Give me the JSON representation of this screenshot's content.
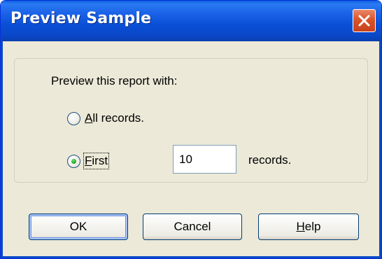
{
  "window": {
    "title": "Preview Sample"
  },
  "group": {
    "prompt": "Preview this report with:"
  },
  "options": {
    "all_records": {
      "label_underlined": "A",
      "label_rest": "ll records.",
      "selected": false
    },
    "first": {
      "label_underlined": "F",
      "label_rest": "irst",
      "selected": true
    }
  },
  "count_input": {
    "value": "10"
  },
  "records_suffix": "records.",
  "buttons": {
    "ok": "OK",
    "cancel": "Cancel",
    "help_underlined": "H",
    "help_rest": "elp"
  },
  "colors": {
    "titlebar": "#0a48c8",
    "close": "#d9542a",
    "dialog_bg": "#ece9d8",
    "radio_dot": "#22a82f"
  },
  "icons": {
    "close": "close-icon"
  }
}
